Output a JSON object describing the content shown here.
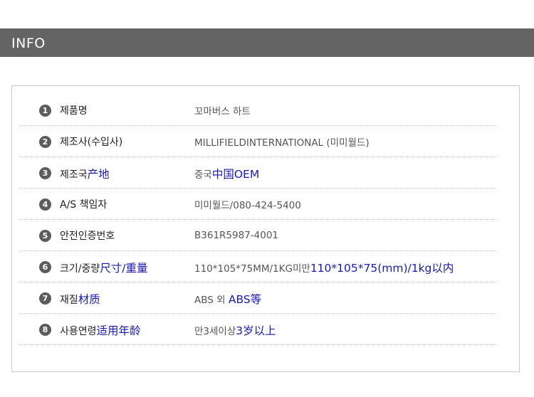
{
  "header": {
    "title": "INFO"
  },
  "rows": [
    {
      "num": "1",
      "label": "제품명",
      "label_cn": "",
      "value": "꼬마버스 하트",
      "value_cn": ""
    },
    {
      "num": "2",
      "label": "제조사(수입사)",
      "label_cn": "",
      "value": "MILLIFIELDINTERNATIONAL (미미월드)",
      "value_cn": ""
    },
    {
      "num": "3",
      "label": "제조국",
      "label_cn": "产地",
      "value": "중국",
      "value_cn": "中国OEM"
    },
    {
      "num": "4",
      "label": "A/S 책임자",
      "label_cn": "",
      "value": "미미월드/080-424-5400",
      "value_cn": ""
    },
    {
      "num": "5",
      "label": "안전인증번호",
      "label_cn": "",
      "value": "B361R5987-4001",
      "value_cn": ""
    },
    {
      "num": "6",
      "label": "크기/중량",
      "label_cn": "尺寸/重量",
      "value": "110*105*75MM/1KG미만",
      "value_cn": "110*105*75(mm)/1kg以内"
    },
    {
      "num": "7",
      "label": "재질",
      "label_cn": "材质",
      "value": "ABS 외 ",
      "value_cn": "ABS等"
    },
    {
      "num": "8",
      "label": "사용연령",
      "label_cn": "适用年龄",
      "value": "만3세이상",
      "value_cn": "3岁以上"
    }
  ]
}
